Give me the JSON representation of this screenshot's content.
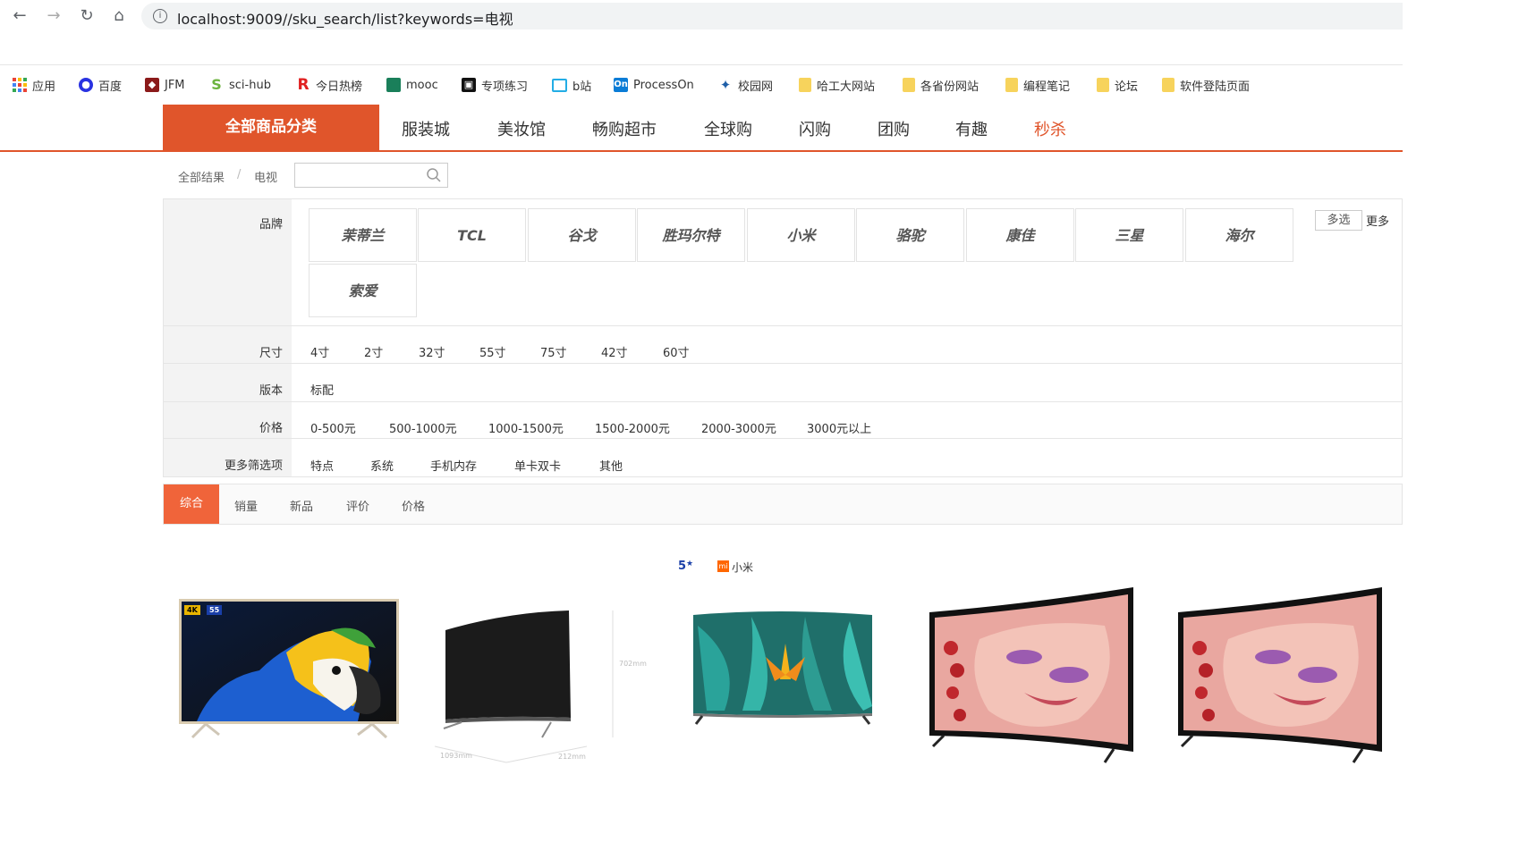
{
  "browser": {
    "url": "localhost:9009//sku_search/list?keywords=电视",
    "bookmarks": [
      {
        "label": "应用",
        "icon": "apps-grid-icon"
      },
      {
        "label": "百度",
        "icon": "baidu-paw-icon"
      },
      {
        "label": "JFM",
        "icon": "jfm-shield-icon"
      },
      {
        "label": "sci-hub",
        "icon": "scihub-s-icon"
      },
      {
        "label": "今日热榜",
        "icon": "r-logo-icon"
      },
      {
        "label": "mooc",
        "icon": "mooc-icon"
      },
      {
        "label": "专项练习",
        "icon": "nowcoder-icon"
      },
      {
        "label": "b站",
        "icon": "bilibili-tv-icon"
      },
      {
        "label": "ProcessOn",
        "icon": "processon-on-icon"
      },
      {
        "label": "校园网",
        "icon": "campus-net-icon"
      },
      {
        "label": "哈工大网站",
        "icon": "folder-icon"
      },
      {
        "label": "各省份网站",
        "icon": "folder-icon"
      },
      {
        "label": "编程笔记",
        "icon": "folder-icon"
      },
      {
        "label": "论坛",
        "icon": "folder-icon"
      },
      {
        "label": "软件登陆页面",
        "icon": "folder-icon"
      }
    ]
  },
  "site_nav": {
    "all_categories": "全部商品分类",
    "items": [
      "服装城",
      "美妆馆",
      "畅购超市",
      "全球购",
      "闪购",
      "团购",
      "有趣",
      "秒杀"
    ],
    "highlight_color": "#e0552b"
  },
  "breadcrumb": {
    "root": "全部结果",
    "separator": "/",
    "current": "电视"
  },
  "filters": {
    "brand": {
      "label": "品牌",
      "items": [
        "茉蒂兰",
        "TCL",
        "谷戈",
        "胜玛尔特",
        "小米",
        "骆驼",
        "康佳",
        "三星",
        "海尔",
        "索爱"
      ],
      "multi_select": "多选",
      "more": "更多"
    },
    "size": {
      "label": "尺寸",
      "options": [
        "4寸",
        "2寸",
        "32寸",
        "55寸",
        "75寸",
        "42寸",
        "60寸"
      ]
    },
    "version": {
      "label": "版本",
      "options": [
        "标配"
      ]
    },
    "price": {
      "label": "价格",
      "options": [
        "0-500元",
        "500-1000元",
        "1000-1500元",
        "1500-2000元",
        "2000-3000元",
        "3000元以上"
      ]
    },
    "more_options": {
      "label": "更多筛选项",
      "options": [
        "特点",
        "系统",
        "手机内存",
        "单卡双卡",
        "其他"
      ]
    }
  },
  "sort": {
    "active": "综合",
    "items": [
      "销量",
      "新品",
      "评价",
      "价格"
    ],
    "active_color": "#f0643a"
  },
  "products": {
    "tv1_badges": [
      "4K",
      "55"
    ],
    "tv2_dims": [
      "702mm",
      "1093mm",
      "212mm"
    ],
    "tv3_brand": "小米",
    "tv3_rating": "5"
  }
}
